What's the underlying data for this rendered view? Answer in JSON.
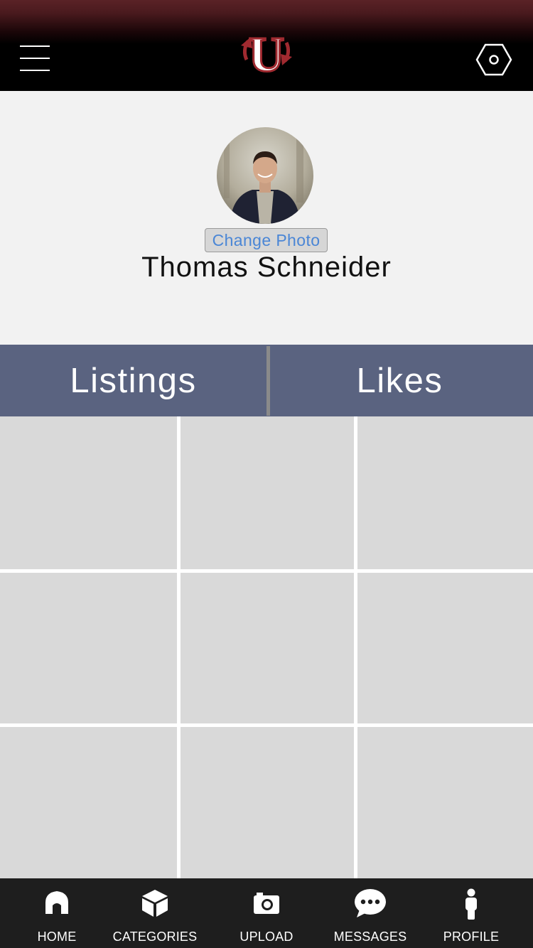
{
  "header": {
    "menu_icon": "hamburger-menu-icon",
    "logo": "U-logo",
    "logo_letter": "U",
    "settings_icon": "hexagon-settings-icon"
  },
  "profile": {
    "change_photo_label": "Change Photo",
    "name": "Thomas Schneider"
  },
  "tabs": [
    {
      "label": "Listings"
    },
    {
      "label": "Likes"
    }
  ],
  "grid": {
    "rows": 3,
    "columns": 3
  },
  "bottom_nav": [
    {
      "label": "HOME",
      "icon": "home-icon"
    },
    {
      "label": "CATEGORIES",
      "icon": "cube-icon"
    },
    {
      "label": "UPLOAD",
      "icon": "camera-icon"
    },
    {
      "label": "MESSAGES",
      "icon": "chat-bubble-icon"
    },
    {
      "label": "PROFILE",
      "icon": "person-icon"
    }
  ],
  "colors": {
    "header_top": "#5a2226",
    "header_bottom": "#000000",
    "tab_background": "#5a6380",
    "grid_cell": "#d9d9d9",
    "link_blue": "#4a86d6",
    "nav_background": "#1e1e1e",
    "logo_red": "#a02a30"
  }
}
